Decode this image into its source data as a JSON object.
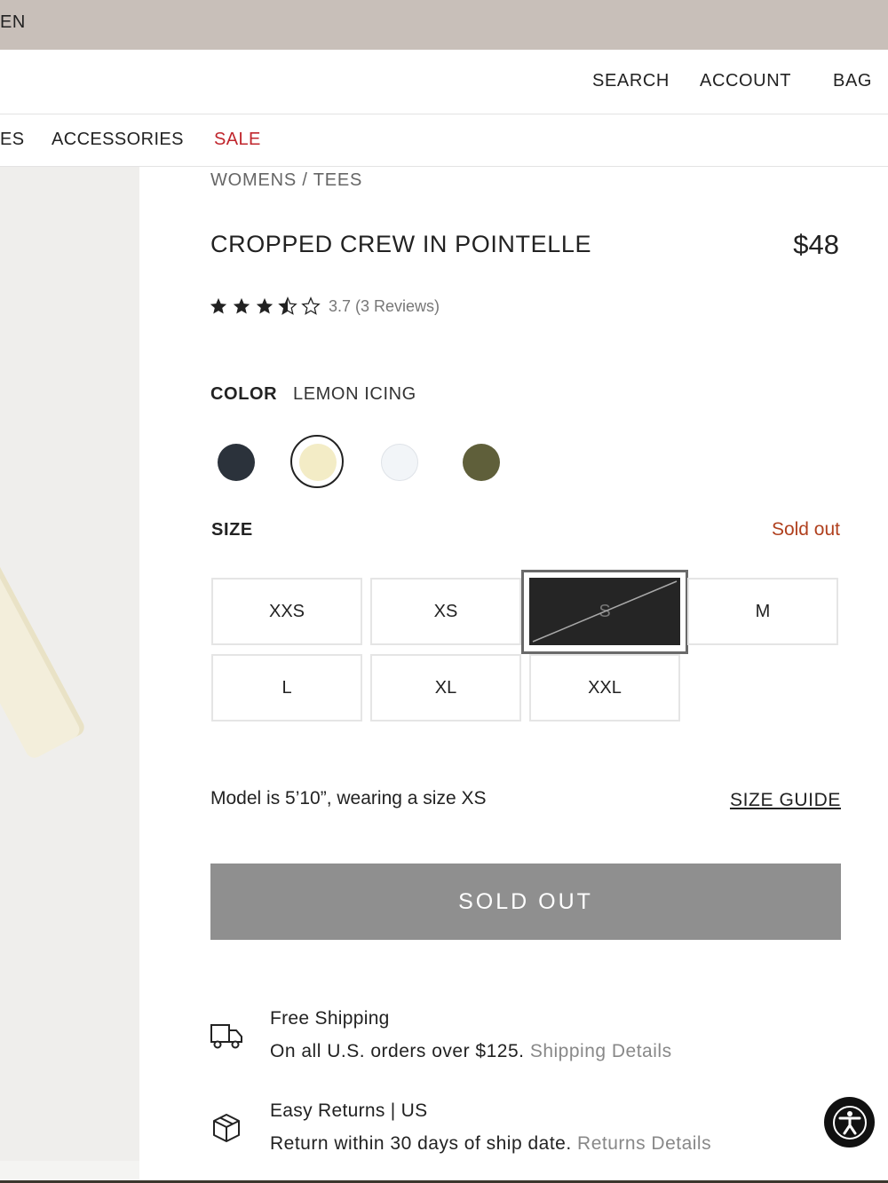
{
  "topbar": {
    "lang": "EN"
  },
  "header": {
    "search": "SEARCH",
    "account": "ACCOUNT",
    "bag": "BAG"
  },
  "nav": {
    "partial": "ES",
    "accessories": "ACCESSORIES",
    "sale": "SALE"
  },
  "product": {
    "breadcrumb": "WOMENS / TEES",
    "title": "CROPPED CREW IN POINTELLE",
    "price": "$48",
    "rating_value": 3.5,
    "rating_text": "3.7 (3 Reviews)"
  },
  "color": {
    "label": "COLOR",
    "selected": "LEMON ICING",
    "swatches": [
      {
        "name": "navy",
        "hex": "#2b323b"
      },
      {
        "name": "lemon-icing",
        "hex": "#f3ecc6",
        "selected": true
      },
      {
        "name": "white",
        "hex": "#f2f5f8"
      },
      {
        "name": "olive",
        "hex": "#5f5f3a"
      }
    ]
  },
  "size": {
    "label": "SIZE",
    "status": "Sold out",
    "options": [
      "XXS",
      "XS",
      "S",
      "M",
      "L",
      "XL",
      "XXL"
    ],
    "soldout": [
      "S"
    ]
  },
  "fit": {
    "model": "Model is 5’10”, wearing a size XS",
    "size_guide": "SIZE GUIDE"
  },
  "cta": {
    "label": "SOLD OUT"
  },
  "shipping": {
    "title": "Free Shipping",
    "text": "On all U.S. orders over $125.",
    "link": "Shipping Details"
  },
  "returns": {
    "title": "Easy Returns | US",
    "text": "Return within 30 days of ship date.",
    "link": "Returns Details"
  },
  "colors": {
    "sale": "#c0262d",
    "sold_out_text": "#b0401e",
    "cta_bg": "#8f8f8f",
    "topbar": "#c8bfb9"
  }
}
